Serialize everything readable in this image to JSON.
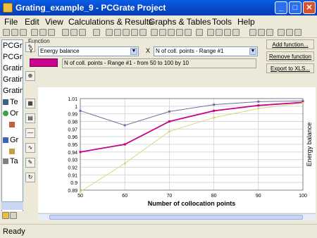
{
  "window": {
    "title": "Grating_example_9 - PCGrate Project",
    "minimize": "_",
    "maximize": "□",
    "close": "✕"
  },
  "menu": [
    "File",
    "Edit",
    "View",
    "Calculations & Results",
    "Graphs & Tables",
    "Tools",
    "Help"
  ],
  "tree": {
    "items": [
      "PCGra",
      "PCGra",
      "Gratin",
      "Gratin",
      "Gratin",
      "Te",
      "Or",
      "",
      "Gr",
      "Ta"
    ]
  },
  "function_panel": {
    "group_label": "Function",
    "y_label": "Y",
    "y_select": "Energy balance",
    "x_sign": "X",
    "x_select": "N of coll. points - Range #1",
    "series_description": "N of coll. points - Range #1 - from 50 to 100 by 10",
    "series_color": "#c8008c"
  },
  "buttons": {
    "add_function": "Add function...",
    "remove_function": "Remove function",
    "export": "Export to XLS..."
  },
  "chart_data": {
    "type": "line",
    "xlabel": "Number of collocation points",
    "ylabel": "Energy balance",
    "xlim": [
      50,
      100
    ],
    "ylim": [
      0.89,
      1.01
    ],
    "x_ticks": [
      50,
      60,
      70,
      80,
      90,
      100
    ],
    "y_ticks": [
      0.89,
      0.9,
      0.91,
      0.92,
      0.93,
      0.94,
      0.95,
      0.96,
      0.97,
      0.98,
      0.99,
      1,
      1.01
    ],
    "grid": true,
    "x": [
      50,
      60,
      70,
      80,
      90,
      100
    ],
    "series": [
      {
        "color": "#7070a0",
        "values": [
          0.994,
          0.975,
          0.993,
          1.002,
          1.006,
          1.007
        ]
      },
      {
        "color": "#c8008c",
        "values": [
          0.94,
          0.95,
          0.98,
          0.994,
          1.001,
          1.005
        ]
      },
      {
        "color": "#d8d880",
        "values": [
          0.888,
          0.925,
          0.967,
          0.985,
          0.997,
          1.004
        ]
      }
    ]
  },
  "status": {
    "text": "Ready"
  }
}
